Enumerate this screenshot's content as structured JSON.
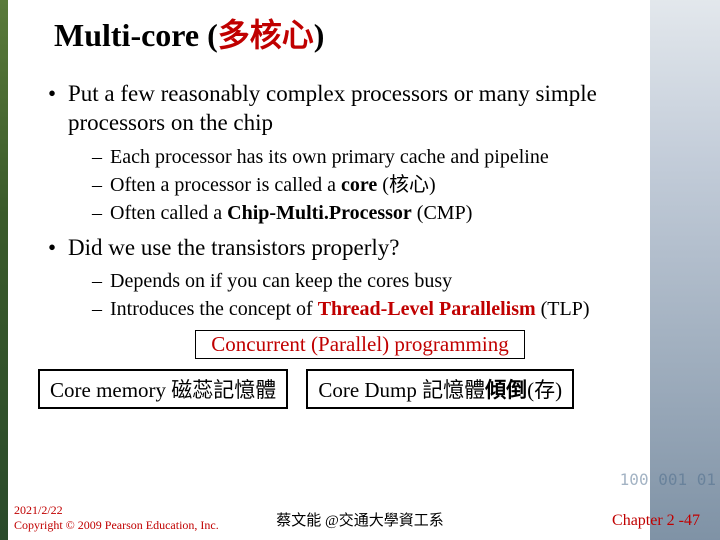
{
  "title": {
    "prefix": "Multi-core (",
    "zh": "多核心",
    "suffix": ")"
  },
  "bullets": [
    {
      "text": "Put a few reasonably complex processors or many simple processors on the chip",
      "subs": [
        {
          "html": "Each processor has its own primary cache and pipeline"
        },
        {
          "html": "Often a processor is called a <span class='bold'>core</span> (核心)"
        },
        {
          "html": "Often called a <span class='bold'>Chip-Multi.Processor</span> (CMP)"
        }
      ]
    },
    {
      "text": "Did we use the transistors properly?",
      "subs": [
        {
          "html": "Depends on if you can keep the cores busy"
        },
        {
          "html": "Introduces the concept of <span class='bold red'>Thread-Level Parallelism</span> (TLP)"
        }
      ]
    }
  ],
  "concurrent_box": "Concurrent (Parallel) programming",
  "box_left": "Core memory 磁蕊記憶體",
  "box_right_prefix": "Core Dump 記憶體",
  "box_right_bold": "傾倒",
  "box_right_suffix": "(存)",
  "footer": {
    "date": "2021/2/22",
    "copyright": "Copyright © 2009 Pearson Education, Inc.",
    "center": "蔡文能 @交通大學資工系",
    "right": "Chapter 2 -47"
  },
  "bgnums": "100\n001\n01"
}
